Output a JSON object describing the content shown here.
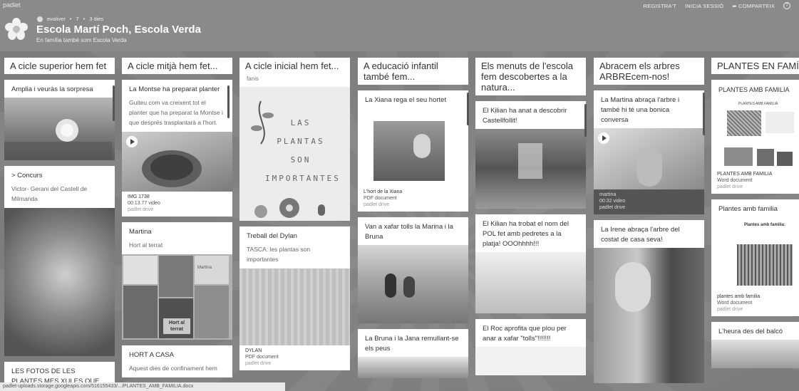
{
  "app": {
    "brand": "padlet",
    "nav": [
      "REGISTRA'T",
      "INICIA SESSIÓ",
      "COMPARTEIX"
    ],
    "help": "?"
  },
  "board": {
    "author": "evaliver",
    "count": "7",
    "age": "3 dies",
    "title": "Escola Martí Poch, Escola Verda",
    "subtitle": "En família també som Escola Verda"
  },
  "columns": [
    {
      "title": "A cicle superior hem fet",
      "cards": [
        {
          "title": "Amplia i veuràs la sorpresa"
        },
        {
          "title": "> Concurs",
          "body": "Victor- Gerani del Castell de Milmanda"
        },
        {
          "title": "LES FOTOS DE LES PLANTES MES XULES QUE HE FET"
        }
      ]
    },
    {
      "title": "A cicle mitjà hem fet...",
      "cards": [
        {
          "title": "La Montse ha preparat planter",
          "body": "Guiteu com va creixent tot el planter que ha preparat la Montse i que després trasplantarà a l'hort.",
          "file": "IMG 1738",
          "meta": "00:13.77 video",
          "src": "padlet drive"
        },
        {
          "title": "Martina",
          "body": "Hort al terrat",
          "img_text_1": "Martina",
          "img_text_2": "Hort al terrat"
        },
        {
          "title": "HORT A CASA",
          "body": "Aquest dies de confinament hem"
        }
      ]
    },
    {
      "title": "A cicle inicial hem fet...",
      "cards": [
        {
          "title": "fanis",
          "drawing": "LAS PLANTAS SON IMPORTANTES"
        },
        {
          "title": "Treball del Dylan",
          "body": "TASCA: les plantas son importantes",
          "file": "DYLAN",
          "meta": "PDF document",
          "src": "padlet drive"
        }
      ]
    },
    {
      "title": "A educació infantil també fem...",
      "cards": [
        {
          "title": "La Xiana rega el seu hortet",
          "file": "L'hort de la Xiana",
          "meta": "PDF document",
          "src": "padlet drive"
        },
        {
          "title": "Van a xafar tolls la Marina i la Bruna"
        },
        {
          "title": "La Bruna i la Jana remullant-se els peus"
        }
      ]
    },
    {
      "title": "Els menuts de l'escola fem descobertes a la natura...",
      "cards": [
        {
          "title": "El Kilian ha anat a descobrir Castellfollit!"
        },
        {
          "title": "El Kilian ha trobat el nom del POL fet amb pedretes a la platja! OOOhhhh!!!"
        },
        {
          "title": "El Roc aprofita que plou per anar a xafar \"tolls\"!!!!!!!"
        }
      ]
    },
    {
      "title": "Abracem els arbres ARBREcem-nos!",
      "cards": [
        {
          "title": "La Martina abraça l'arbre i també hi té una bonica conversa",
          "file": "martina",
          "meta": "00:32 video",
          "src": "padlet drive"
        },
        {
          "title": "La Irene abraça l'arbre del costat de casa seva!"
        }
      ]
    },
    {
      "title": "PLANTES EN FAMÍLIA",
      "cards": [
        {
          "title": "PLANTES AMB FAMILIA",
          "doc_title": "PLANTES AMB FAMILIA",
          "file": "PLANTES AMB FAMILIA",
          "meta": "Word document",
          "src": "padlet drive"
        },
        {
          "title": "Plantes amb familia",
          "doc_title": "Plantes amb familia:",
          "file": "plantes amb familia",
          "meta": "Word document",
          "src": "padlet drive"
        },
        {
          "title": "L'heura des del balcó"
        }
      ]
    }
  ],
  "status": "padlet-uploads.storage.googleapis.com/516155433/.../PLANTES_AMB_FAMILIA.docx"
}
